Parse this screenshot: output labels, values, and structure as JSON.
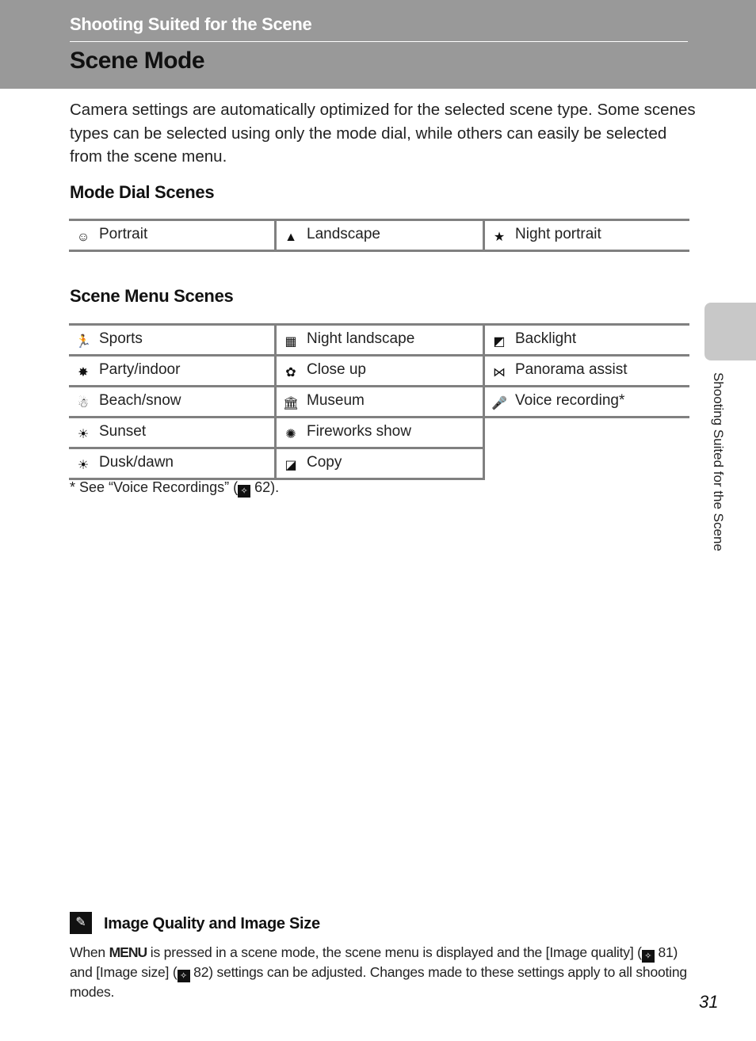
{
  "header": {
    "section": "Shooting Suited for the Scene",
    "title": "Scene Mode"
  },
  "intro": "Camera settings are automatically optimized for the selected scene type. Some scenes types can be selected using only the mode dial, while others can easily be selected from the scene menu.",
  "mode_dial": {
    "heading": "Mode Dial Scenes",
    "items": [
      {
        "icon": "portrait-icon",
        "glyph": "☺",
        "label": "Portrait"
      },
      {
        "icon": "landscape-icon",
        "glyph": "▲",
        "label": "Landscape"
      },
      {
        "icon": "night-portrait-icon",
        "glyph": "★",
        "label": "Night portrait"
      }
    ]
  },
  "scene_menu": {
    "heading": "Scene Menu Scenes",
    "rows": [
      [
        {
          "icon": "sports-icon",
          "glyph": "🏃",
          "label": "Sports"
        },
        {
          "icon": "night-landscape-icon",
          "glyph": "▦",
          "label": "Night landscape"
        },
        {
          "icon": "backlight-icon",
          "glyph": "◩",
          "label": "Backlight"
        }
      ],
      [
        {
          "icon": "party-indoor-icon",
          "glyph": "✸",
          "label": "Party/indoor"
        },
        {
          "icon": "close-up-icon",
          "glyph": "✿",
          "label": "Close up"
        },
        {
          "icon": "panorama-assist-icon",
          "glyph": "⋈",
          "label": "Panorama assist"
        }
      ],
      [
        {
          "icon": "beach-snow-icon",
          "glyph": "☃",
          "label": "Beach/snow"
        },
        {
          "icon": "museum-icon",
          "glyph": "🏛",
          "label": "Museum"
        },
        {
          "icon": "voice-recording-icon",
          "glyph": "🎤",
          "label": "Voice recording*"
        }
      ],
      [
        {
          "icon": "sunset-icon",
          "glyph": "☀",
          "label": "Sunset"
        },
        {
          "icon": "fireworks-show-icon",
          "glyph": "✺",
          "label": "Fireworks show"
        }
      ],
      [
        {
          "icon": "dusk-dawn-icon",
          "glyph": "☀",
          "label": "Dusk/dawn"
        },
        {
          "icon": "copy-icon",
          "glyph": "◪",
          "label": "Copy"
        }
      ]
    ]
  },
  "footnote": {
    "prefix": "*  See “Voice Recordings” (",
    "ref_icon": "reference-icon",
    "page": " 62)."
  },
  "side_tab": {
    "label": "Shooting Suited for the Scene"
  },
  "tip": {
    "icon": "tip-icon",
    "title": "Image Quality and Image Size",
    "body_1": "When ",
    "menu_key": "MENU",
    "body_2": " is pressed in a scene mode, the scene menu is displayed and the [Image quality] (",
    "ref1": " 81) and [Image size] (",
    "ref2": " 82) settings can be adjusted. Changes made to these settings apply to all shooting modes."
  },
  "page_number": "31",
  "ref_glyph": "✧"
}
